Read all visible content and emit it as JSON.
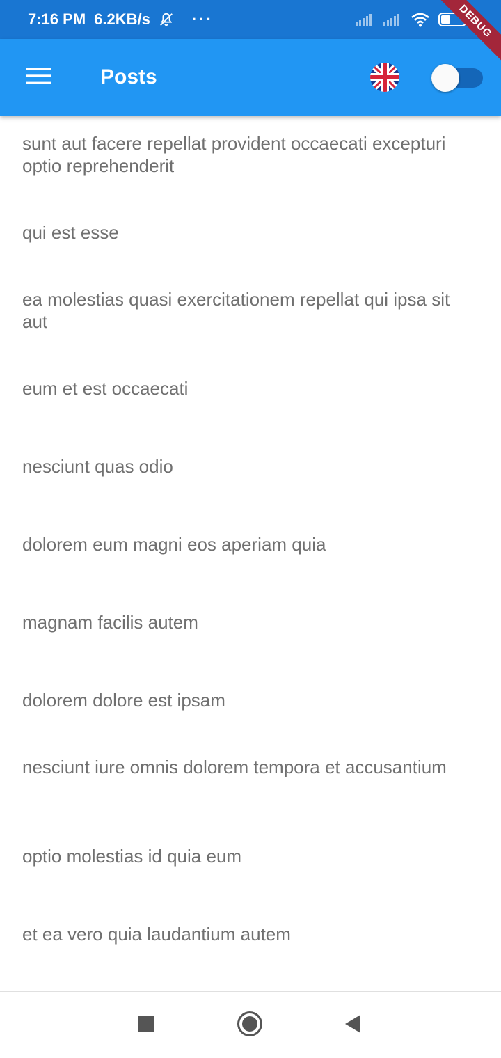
{
  "status_bar": {
    "time": "7:16 PM",
    "network_speed": "6.2KB/s",
    "more_indicator": "···",
    "battery": "34",
    "icons": [
      "bell-off-icon",
      "signal-icon",
      "signal-icon",
      "wifi-icon",
      "battery-icon"
    ]
  },
  "debug_banner": "DEBUG",
  "app_bar": {
    "title": "Posts",
    "menu_icon": "menu-icon",
    "language_icon": "uk-flag-icon",
    "toggle_state": "off",
    "color": "#2196f3"
  },
  "posts": [
    "sunt aut facere repellat provident occaecati excepturi optio reprehenderit",
    "qui est esse",
    "ea molestias quasi exercitationem repellat qui ipsa sit aut",
    "eum et est occaecati",
    "nesciunt quas odio",
    "dolorem eum magni eos aperiam quia",
    "magnam facilis autem",
    "dolorem dolore est ipsam",
    "nesciunt iure omnis dolorem tempora et accusantium",
    "optio molestias id quia eum",
    "et ea vero quia laudantium autem"
  ],
  "nav_bar": {
    "icons": [
      "recents-square-icon",
      "home-circle-icon",
      "back-triangle-icon"
    ]
  }
}
